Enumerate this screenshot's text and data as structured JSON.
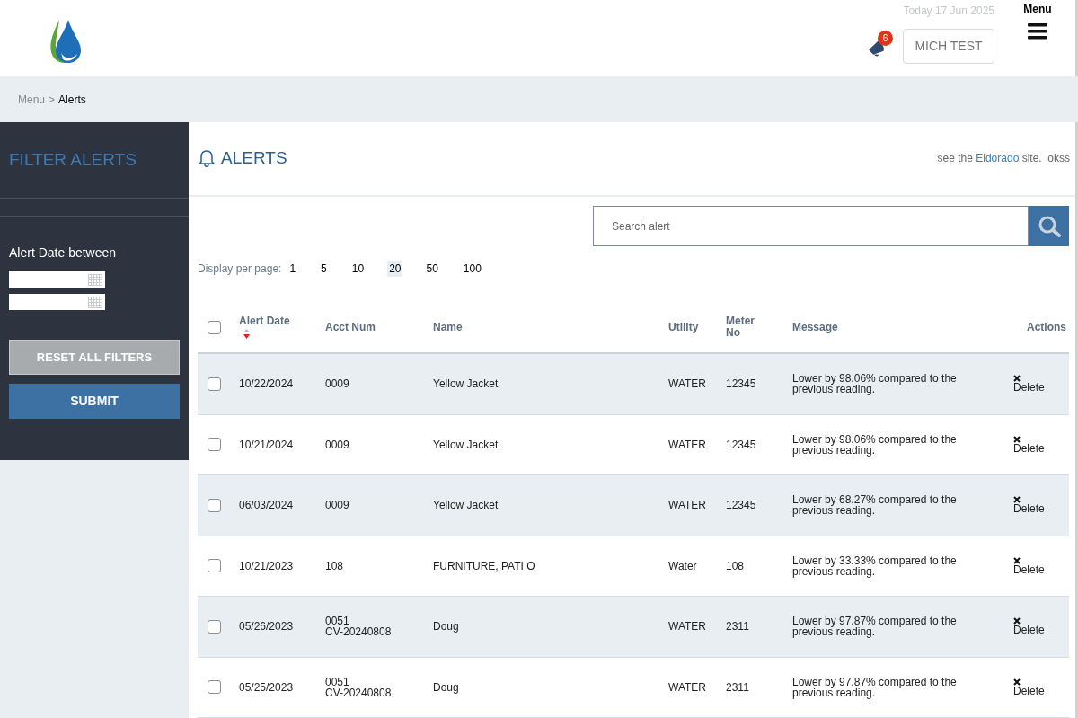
{
  "header": {
    "date": "Today 17 Jun 2025",
    "menu_label": "Menu",
    "notification_count": "6",
    "user_button": "MICH TEST"
  },
  "breadcrumb": {
    "parent": "Menu",
    "separator": ">",
    "current": "Alerts"
  },
  "sidebar": {
    "title": "FILTER ALERTS",
    "date_label": "Alert Date between",
    "date_fields": [
      {
        "kind": "date"
      },
      {
        "kind": "date"
      }
    ],
    "reset_button": "RESET ALL FILTERS",
    "submit_button": "SUBMIT"
  },
  "main": {
    "title": "ALERTS",
    "note_prefix": "see the",
    "note_link": "Eldorado",
    "note_suffix": "site.  okss",
    "search": {
      "placeholder": "Search alert"
    },
    "per_page_label": "Display per page:",
    "per_page_options": [
      {
        "label": "1",
        "selected": false
      },
      {
        "label": "5",
        "selected": false
      },
      {
        "label": "10",
        "selected": false
      },
      {
        "label": "20",
        "selected": true
      },
      {
        "label": "50",
        "selected": false
      },
      {
        "label": "100",
        "selected": false
      }
    ]
  },
  "table": {
    "select_all": {
      "checked": false
    },
    "columns": [
      {
        "label": "Alert Date",
        "sorted": true
      },
      {
        "label": "Acct Num",
        "sorted": false
      },
      {
        "label": "Name",
        "sorted": false
      },
      {
        "label": "Utility",
        "sorted": false
      },
      {
        "label": "Meter No",
        "sorted": false
      },
      {
        "label": "Message",
        "sorted": false
      },
      {
        "label": "Actions",
        "sorted": false
      }
    ],
    "rows": [
      {
        "checked": false,
        "date": "10/22/2024",
        "acct": [
          "0009"
        ],
        "name": "Yellow Jacket",
        "utility": "WATER",
        "meter": "12345",
        "message": "Lower by 98.06% compared to the previous reading.",
        "action": "Delete"
      },
      {
        "checked": false,
        "date": "10/21/2024",
        "acct": [
          "0009"
        ],
        "name": "Yellow Jacket",
        "utility": "WATER",
        "meter": "12345",
        "message": "Lower by 98.06% compared to the previous reading.",
        "action": "Delete"
      },
      {
        "checked": false,
        "date": "06/03/2024",
        "acct": [
          "0009"
        ],
        "name": "Yellow Jacket",
        "utility": "WATER",
        "meter": "12345",
        "message": "Lower by 68.27% compared to the previous reading.",
        "action": "Delete"
      },
      {
        "checked": false,
        "date": "10/21/2023",
        "acct": [
          "108"
        ],
        "name": "FURNITURE, PATI O",
        "utility": "Water",
        "meter": "108",
        "message": "Lower by 33.33% compared to the previous reading.",
        "action": "Delete"
      },
      {
        "checked": false,
        "date": "05/26/2023",
        "acct": [
          "0051",
          "CV-20240808"
        ],
        "name": "Doug",
        "utility": "WATER",
        "meter": "2311",
        "message": "Lower by 97.87% compared to the previous reading.",
        "action": "Delete"
      },
      {
        "checked": false,
        "date": "05/25/2023",
        "acct": [
          "0051",
          "CV-20240808"
        ],
        "name": "Doug",
        "utility": "WATER",
        "meter": "2311",
        "message": "Lower by 97.87% compared to the previous reading.",
        "action": "Delete"
      }
    ]
  }
}
